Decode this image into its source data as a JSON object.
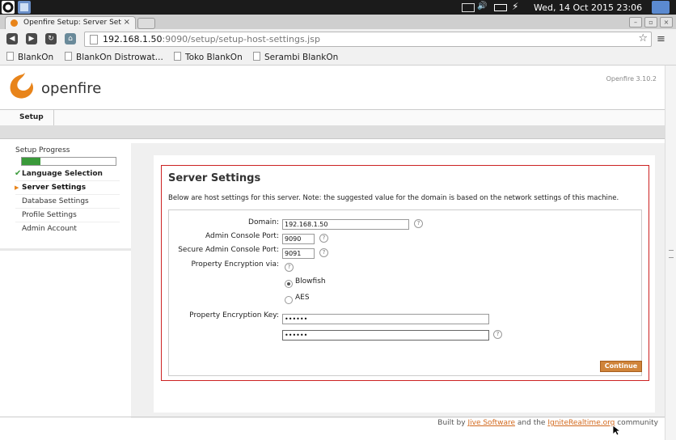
{
  "system": {
    "clock": "Wed, 14 Oct 2015 23:06"
  },
  "browser": {
    "tab_title": "Openfire Setup: Server Set",
    "url_host": "192.168.1.50",
    "url_path": ":9090/setup/setup-host-settings.jsp",
    "bookmarks": [
      "BlankOn",
      "BlankOn Distrowat...",
      "Toko BlankOn",
      "Serambi BlankOn"
    ]
  },
  "app": {
    "brand": "openfire",
    "version": "Openfire 3.10.2",
    "nav_tab": "Setup"
  },
  "sidebar": {
    "title": "Setup Progress",
    "progress": 0.2,
    "steps": [
      {
        "label": "Language Selection",
        "state": "done"
      },
      {
        "label": "Server Settings",
        "state": "active"
      },
      {
        "label": "Database Settings",
        "state": "pending"
      },
      {
        "label": "Profile Settings",
        "state": "pending"
      },
      {
        "label": "Admin Account",
        "state": "pending"
      }
    ]
  },
  "form": {
    "title": "Server Settings",
    "description": "Below are host settings for this server. Note: the suggested value for the domain is based on the network settings of this machine.",
    "domain_label": "Domain:",
    "domain_value": "192.168.1.50",
    "admin_port_label": "Admin Console Port:",
    "admin_port_value": "9090",
    "secure_port_label": "Secure Admin Console Port:",
    "secure_port_value": "9091",
    "encryption_label": "Property Encryption via:",
    "option_blowfish": "Blowfish",
    "option_aes": "AES",
    "selected_option": "Blowfish",
    "key_label": "Property Encryption Key:",
    "key_value": "••••••",
    "key_confirm_value": "••••••",
    "continue_label": "Continue"
  },
  "footer": {
    "prefix": "Built by",
    "link1": "Jive Software",
    "middle": "and the",
    "link2": "IgniteRealtime.org",
    "suffix": "community"
  },
  "colors": {
    "accent": "#d0843a",
    "panel_border": "#cc2222",
    "progress": "#3a9a3a"
  }
}
